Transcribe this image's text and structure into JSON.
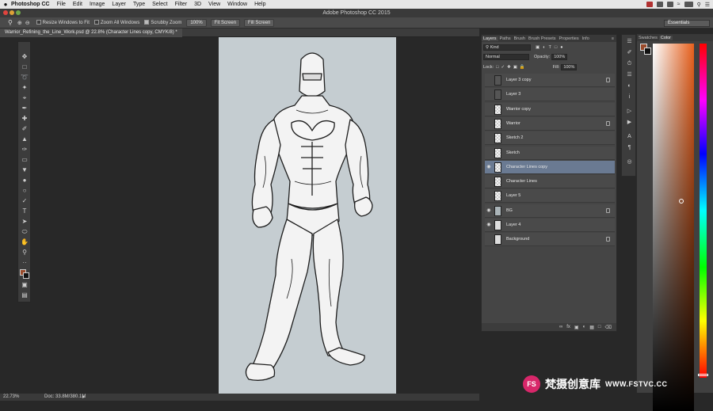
{
  "menubar": {
    "apple": "",
    "app_name": "Photoshop CC",
    "items": [
      "File",
      "Edit",
      "Image",
      "Layer",
      "Type",
      "Select",
      "Filter",
      "3D",
      "View",
      "Window",
      "Help"
    ]
  },
  "window": {
    "title": "Adobe Photoshop CC 2015"
  },
  "options_bar": {
    "resize_windows": "Resize Windows to Fit",
    "zoom_all": "Zoom All Windows",
    "scrubby_zoom": "Scrubby Zoom",
    "zoom_value": "100%",
    "fit_screen": "Fit Screen",
    "fill_screen": "Fill Screen",
    "workspace": "Essentials"
  },
  "document": {
    "tab_title": "Warrior_Refining_the_Line_Work.psd @ 22.8% (Character Lines copy, CMYK/8) *"
  },
  "status": {
    "zoom": "22.73%",
    "doc_size": "Doc: 33.8M/380.1M"
  },
  "layers_panel": {
    "tabs": [
      "Layers",
      "Paths",
      "Brush",
      "Brush Presets",
      "Properties",
      "Info"
    ],
    "active_tab": "Layers",
    "kind": "Kind",
    "blend_mode": "Normal",
    "opacity_label": "Opacity:",
    "opacity": "100%",
    "lock_label": "Lock:",
    "fill_label": "Fill:",
    "fill": "100%",
    "layers": [
      {
        "name": "Layer 3 copy",
        "visible": false,
        "locked": true,
        "thumb": "dark",
        "selected": false
      },
      {
        "name": "Layer 3",
        "visible": false,
        "locked": false,
        "thumb": "dark",
        "selected": false
      },
      {
        "name": "Warrior copy",
        "visible": false,
        "locked": false,
        "thumb": "checker",
        "selected": false
      },
      {
        "name": "Warrior",
        "visible": false,
        "locked": true,
        "thumb": "checker",
        "selected": false
      },
      {
        "name": "Sketch 2",
        "visible": false,
        "locked": false,
        "thumb": "checker",
        "selected": false
      },
      {
        "name": "Sketch",
        "visible": false,
        "locked": false,
        "thumb": "checker",
        "selected": false
      },
      {
        "name": "Character Lines copy",
        "visible": true,
        "locked": false,
        "thumb": "checker",
        "selected": true
      },
      {
        "name": "Character Lines",
        "visible": false,
        "locked": false,
        "thumb": "checker",
        "selected": false
      },
      {
        "name": "Layer 5",
        "visible": false,
        "locked": false,
        "thumb": "checker",
        "selected": false
      },
      {
        "name": "BG",
        "visible": true,
        "locked": true,
        "thumb": "grey",
        "selected": false
      },
      {
        "name": "Layer 4",
        "visible": true,
        "locked": false,
        "thumb": "white",
        "selected": false
      },
      {
        "name": "Background",
        "visible": false,
        "locked": true,
        "thumb": "white",
        "selected": false
      }
    ],
    "footer_icons": [
      "link-icon",
      "fx-icon",
      "mask-icon",
      "adjustment-icon",
      "group-icon",
      "new-layer-icon",
      "trash-icon"
    ]
  },
  "color_panel": {
    "tabs": [
      "Swatches",
      "Color"
    ],
    "active_tab": "Color",
    "base_hue_color": "#e8601c"
  },
  "colors": {
    "foreground": "#9a4a2a",
    "background": "#111111",
    "selection": "#6a7a92",
    "canvas_bg": "#c5cdd1"
  },
  "watermark": {
    "logo": "FS",
    "text": "梵摄创意库",
    "site": "WWW.FSTVC.CC"
  }
}
